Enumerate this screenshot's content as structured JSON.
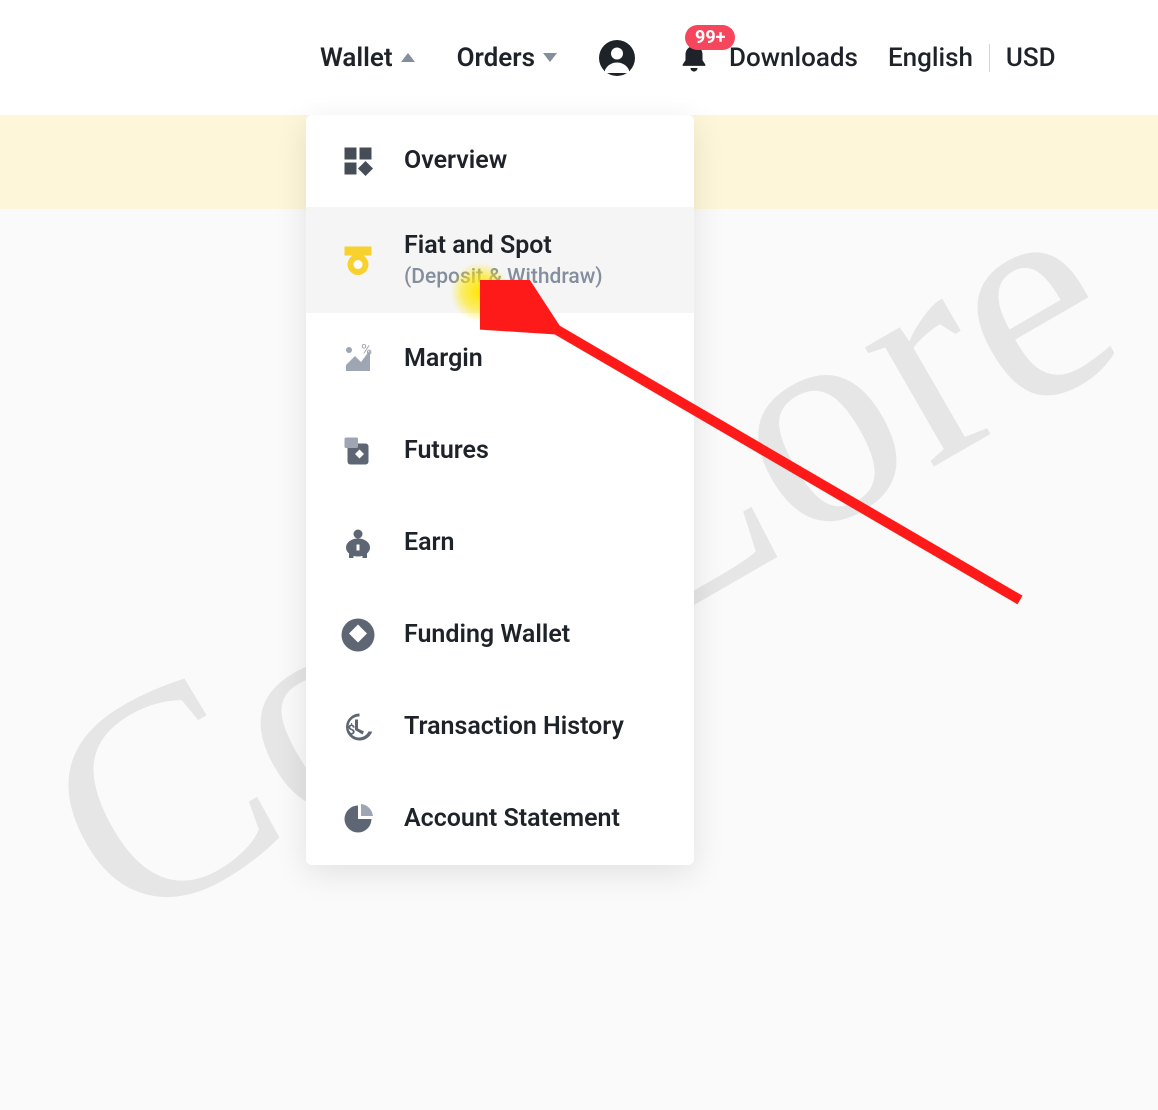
{
  "header": {
    "wallet": "Wallet",
    "orders": "Orders",
    "notif_badge": "99+",
    "downloads": "Downloads",
    "language": "English",
    "currency": "USD"
  },
  "menu": {
    "items": [
      {
        "label": "Overview"
      },
      {
        "label": "Fiat and Spot",
        "sub": "(Deposit & Withdraw)"
      },
      {
        "label": "Margin"
      },
      {
        "label": "Futures"
      },
      {
        "label": "Earn"
      },
      {
        "label": "Funding Wallet"
      },
      {
        "label": "Transaction History"
      },
      {
        "label": "Account Statement"
      }
    ]
  }
}
